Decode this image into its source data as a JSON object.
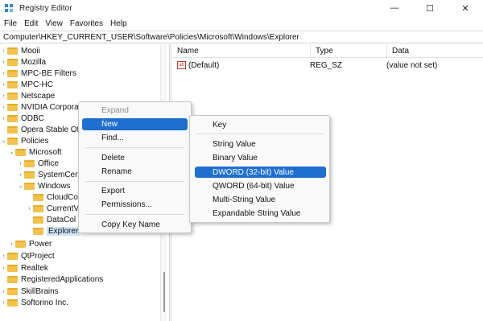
{
  "window": {
    "title": "Registry Editor",
    "controls": {
      "minimize": "—",
      "maximize": "☐",
      "close": "✕"
    }
  },
  "menubar": [
    "File",
    "Edit",
    "View",
    "Favorites",
    "Help"
  ],
  "address": "Computer\\HKEY_CURRENT_USER\\Software\\Policies\\Microsoft\\Windows\\Explorer",
  "tree": [
    {
      "label": "Mooii",
      "chevron": "›"
    },
    {
      "label": "Mozilla",
      "chevron": "›"
    },
    {
      "label": "MPC-BE Filters",
      "chevron": "›"
    },
    {
      "label": "MPC-HC",
      "chevron": "›"
    },
    {
      "label": "Netscape",
      "chevron": "›"
    },
    {
      "label": "NVIDIA Corporati",
      "chevron": "›"
    },
    {
      "label": "ODBC",
      "chevron": "›"
    },
    {
      "label": "Opera Stable Offe",
      "chevron": ""
    },
    {
      "label": "Policies",
      "chevron": "⌄"
    },
    {
      "label": "Microsoft",
      "chevron": "⌄"
    },
    {
      "label": "Office",
      "chevron": "›"
    },
    {
      "label": "SystemCert",
      "chevron": "›"
    },
    {
      "label": "Windows",
      "chevron": "⌄"
    },
    {
      "label": "CloudCo",
      "chevron": ""
    },
    {
      "label": "CurrentV",
      "chevron": "›"
    },
    {
      "label": "DataCol",
      "chevron": ""
    },
    {
      "label": "Explorer",
      "chevron": ""
    },
    {
      "label": "Power",
      "chevron": "›"
    },
    {
      "label": "QtProject",
      "chevron": "›"
    },
    {
      "label": "Realtek",
      "chevron": "›"
    },
    {
      "label": "RegisteredApplications",
      "chevron": ""
    },
    {
      "label": "SkillBrains",
      "chevron": "›"
    },
    {
      "label": "Softorino Inc.",
      "chevron": "›"
    }
  ],
  "columns": {
    "name": "Name",
    "type": "Type",
    "data": "Data"
  },
  "values": [
    {
      "icon": "ab",
      "name": "(Default)",
      "type": "REG_SZ",
      "data": "(value not set)"
    }
  ],
  "context_menu": {
    "items": [
      "Expand",
      "New",
      "Find...",
      "Delete",
      "Rename",
      "Export",
      "Permissions...",
      "Copy Key Name"
    ]
  },
  "submenu": {
    "items": [
      "Key",
      "String Value",
      "Binary Value",
      "DWORD (32-bit) Value",
      "QWORD (64-bit) Value",
      "Multi-String Value",
      "Expandable String Value"
    ]
  },
  "colors": {
    "highlight": "#1f6fd1",
    "folder": "#f2c24d",
    "selection": "#cde3f7"
  }
}
